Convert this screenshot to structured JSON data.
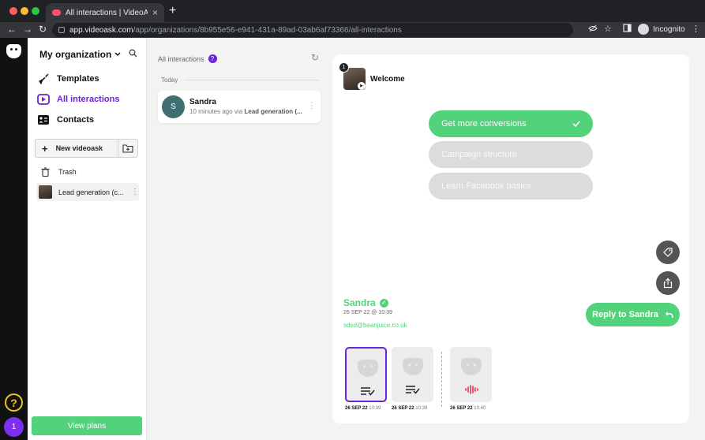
{
  "browser": {
    "tab_title": "All interactions | VideoAsk",
    "url_host": "app.videoask.com",
    "url_path": "/app/organizations/8b955e56-e941-431a-89ad-03ab6af73366/all-interactions",
    "profile_label": "Incognito"
  },
  "sidebar": {
    "org_name": "My organization",
    "nav": [
      {
        "label": "Templates",
        "icon": "rocket-icon"
      },
      {
        "label": "All interactions",
        "icon": "play-icon",
        "active": true
      },
      {
        "label": "Contacts",
        "icon": "contacts-icon"
      }
    ],
    "new_videoask_label": "New videoask",
    "trash_label": "Trash",
    "folder_item_label": "Lead generation (c...",
    "view_plans_label": "View plans"
  },
  "rail": {
    "help_glyph": "?",
    "user_badge": "1"
  },
  "list_panel": {
    "title": "All interactions",
    "help_glyph": "?",
    "day_label": "Today",
    "card": {
      "avatar_initial": "S",
      "name": "Sandra",
      "time": "10 minutes ago via",
      "source": "Lead generation (..."
    }
  },
  "detail": {
    "step_number": "1",
    "step_title": "Welcome",
    "options": [
      {
        "label": "Get more conversions",
        "selected": true
      },
      {
        "label": "Campaign structure",
        "selected": false
      },
      {
        "label": "Learn Facebook basics",
        "selected": false
      }
    ],
    "contact_name": "Sandra",
    "contact_date": "26 SEP 22 @ 10:39",
    "contact_email": "sdsd@beanjuice.co.uk",
    "reply_label": "Reply to Sandra",
    "responses": [
      {
        "date": "26 SEP 22",
        "time": "10:39",
        "type": "text"
      },
      {
        "date": "26 SEP 22",
        "time": "10:39",
        "type": "text"
      },
      {
        "date": "26 SEP 22",
        "time": "10:40",
        "type": "audio"
      }
    ]
  },
  "colors": {
    "brand_green": "#52d27a",
    "brand_purple": "#6b22d8",
    "audio_red": "#e0344b"
  }
}
